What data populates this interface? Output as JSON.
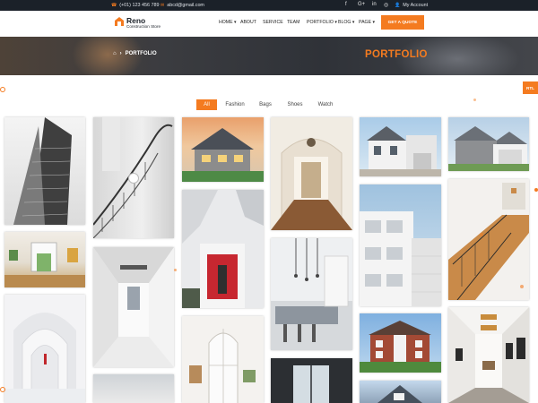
{
  "topbar": {
    "phone": "(+01) 123 456 789",
    "email": "abcd@gmail.com",
    "socials": [
      "facebook-icon",
      "google-plus-icon",
      "linkedin-icon",
      "instagram-icon"
    ],
    "account": "My Account"
  },
  "brand": {
    "title": "Reno",
    "subtitle": "Construction Store"
  },
  "nav": {
    "items": [
      {
        "label": "HOME",
        "caret": true
      },
      {
        "label": "ABOUT",
        "caret": false
      },
      {
        "label": "SERVICE",
        "caret": false
      },
      {
        "label": "TEAM",
        "caret": false
      },
      {
        "label": "PORTFOLIO",
        "caret": true
      },
      {
        "label": "BLOG",
        "caret": true
      },
      {
        "label": "PAGE",
        "caret": true
      }
    ],
    "cta": "GET A QUOTE"
  },
  "breadcrumb": {
    "current": "PORTFOLIO"
  },
  "page_title": "PORTFOLIO",
  "rtl_label": "RTL",
  "filters": [
    "All",
    "Fashion",
    "Bags",
    "Shoes",
    "Watch"
  ],
  "portfolio": {
    "items": [
      "skyscraper",
      "spiral-staircase",
      "suburban-house",
      "arched-hallway",
      "white-villa",
      "grey-house",
      "living-room",
      "white-atrium",
      "red-door",
      "kitchen",
      "white-apartments",
      "wooden-staircase",
      "white-arches",
      "arched-window",
      "brick-house",
      "gallery-hallway"
    ]
  },
  "colors": {
    "accent": "#f47b20",
    "topbar": "#1b2129"
  }
}
